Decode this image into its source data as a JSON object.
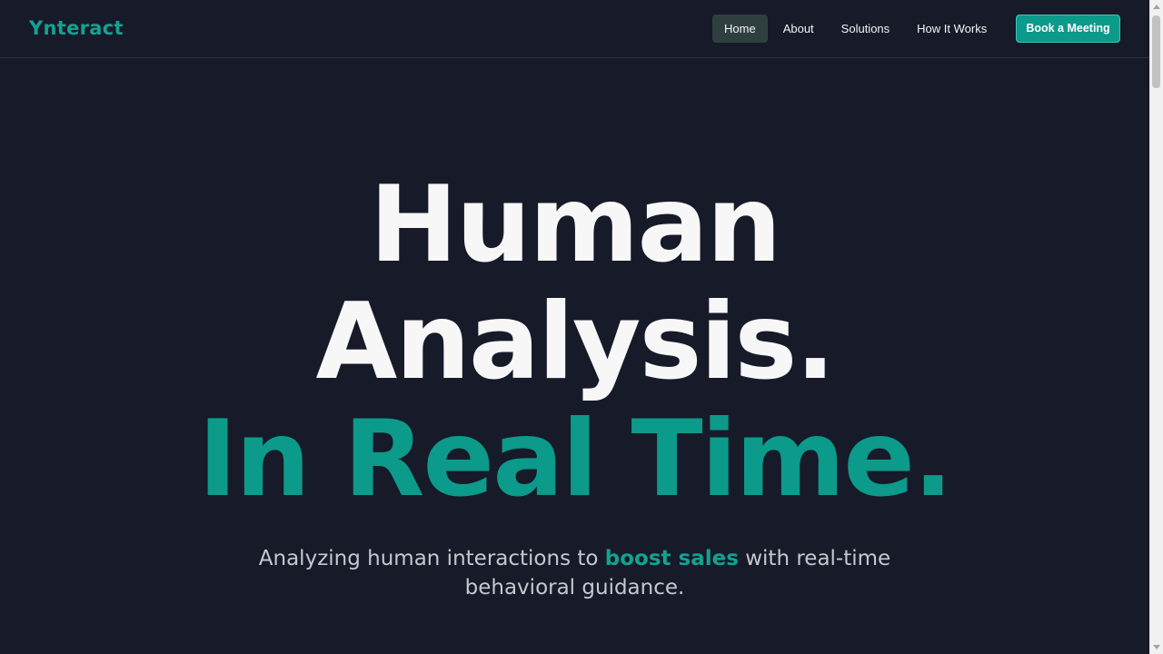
{
  "brand": {
    "logo_text": "Ynteract",
    "accent_color": "#0c9a8a",
    "background_color": "#171a29"
  },
  "nav": {
    "items": [
      {
        "label": "Home",
        "active": true
      },
      {
        "label": "About",
        "active": false
      },
      {
        "label": "Solutions",
        "active": false
      },
      {
        "label": "How It Works",
        "active": false
      }
    ],
    "cta_label": "Book a Meeting"
  },
  "hero": {
    "line1": "Human",
    "line2": "Analysis.",
    "line3": "In Real Time.",
    "subtitle_before": "Analyzing human interactions to ",
    "subtitle_highlight": "boost sales",
    "subtitle_after": " with real-time behavioral guidance."
  }
}
